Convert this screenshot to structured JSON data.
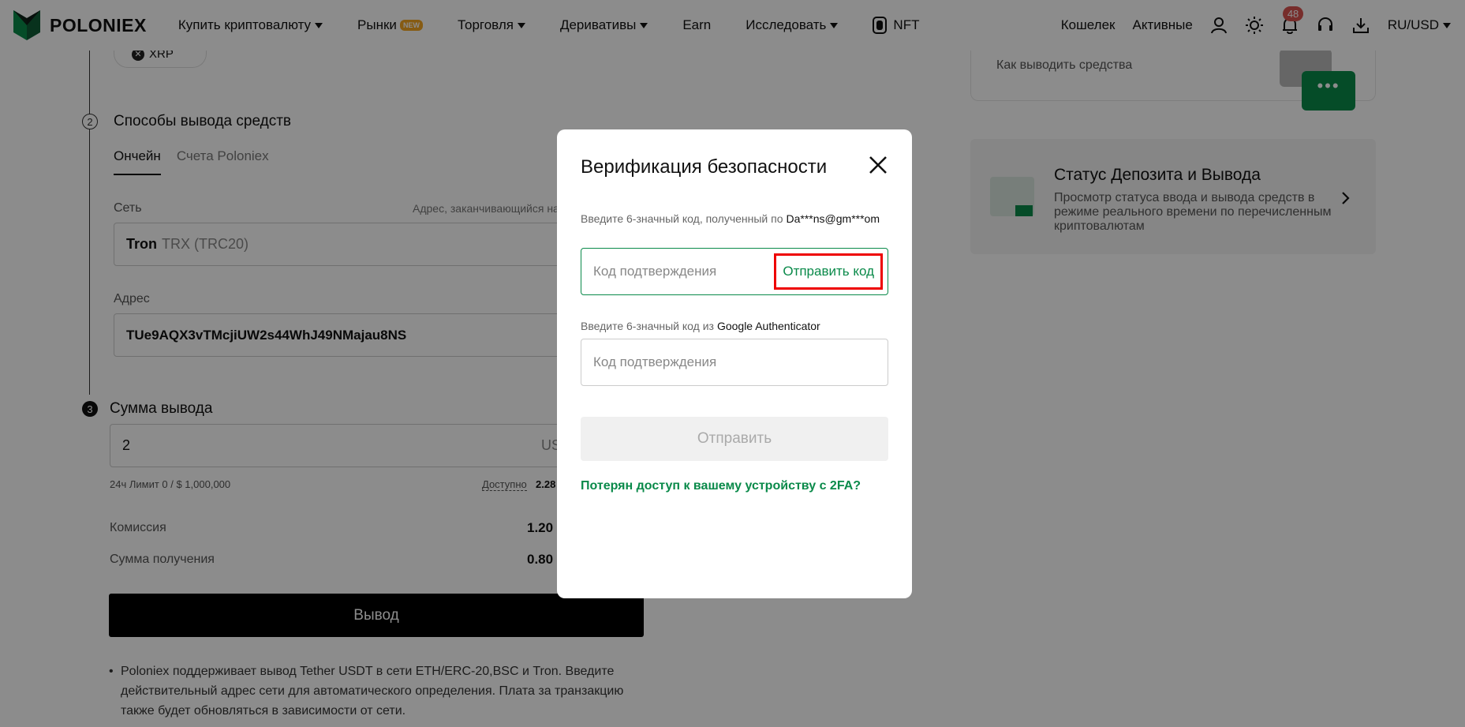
{
  "header": {
    "logo_text": "POLONIEX",
    "nav": [
      {
        "label": "Купить криптовалюту",
        "caret": true
      },
      {
        "label": "Рынки",
        "badge": "NEW"
      },
      {
        "label": "Торговля",
        "caret": true
      },
      {
        "label": "Деривативы",
        "caret": true
      },
      {
        "label": "Earn"
      },
      {
        "label": "Исследовать",
        "caret": true
      },
      {
        "label": "NFT"
      }
    ],
    "wallet": "Кошелек",
    "assets": "Активные",
    "notifications_count": "48",
    "locale": "RU/USD"
  },
  "page": {
    "coin_chip": "XRP",
    "step2": {
      "number": "2",
      "title": "Способы вывода средств"
    },
    "tabs": [
      "Ончейн",
      "Счета Poloniex"
    ],
    "network": {
      "label": "Сеть",
      "hint": "Адрес, заканчивающийся на",
      "value_main": "Tron",
      "value_sub": "TRX (TRC20)"
    },
    "address": {
      "label": "Адрес",
      "value": "TUe9AQX3vTMcjiUW2s44WhJ49NMajau8NS"
    },
    "step3": {
      "number": "3",
      "title": "Сумма вывода"
    },
    "amount": {
      "value": "2",
      "unit": "US"
    },
    "limit": "24ч Лимит  0 / $ 1,000,000",
    "available_label": "Доступно",
    "available_value": "2.28",
    "fee": {
      "label": "Комиссия",
      "value": "1.20"
    },
    "receive": {
      "label": "Сумма получения",
      "value": "0.80"
    },
    "withdraw_button": "Вывод",
    "note": "Poloniex поддерживает вывод Tether USDT в сети ETH/ERC-20,BSC и Tron. Введите действительный адрес сети для автоматического определения. Плата за транзакцию также будет обновляться в зависимости от сети."
  },
  "sidebar": {
    "how_to": "Как выводить средства",
    "status_title": "Статус Депозита и Вывода",
    "status_desc": "Просмотр статуса ввода и вывода средств в режиме реального времени по перечисленным криптовалютам"
  },
  "modal": {
    "title": "Верификация безопасности",
    "email_label": "Введите 6-значный код, полученный по",
    "email_value": "Da***ns@gm***om",
    "email_placeholder": "Код подтверждения",
    "send_code": "Отправить код",
    "ga_label": "Введите 6-значный код из",
    "ga_value": "Google Authenticator",
    "ga_placeholder": "Код подтверждения",
    "submit": "Отправить",
    "lost_2fa": "Потерян доступ к вашему устройству с 2FA?"
  },
  "colors": {
    "accent": "#0a8a4a",
    "highlight": "#e00000",
    "badge": "#d9534f"
  }
}
